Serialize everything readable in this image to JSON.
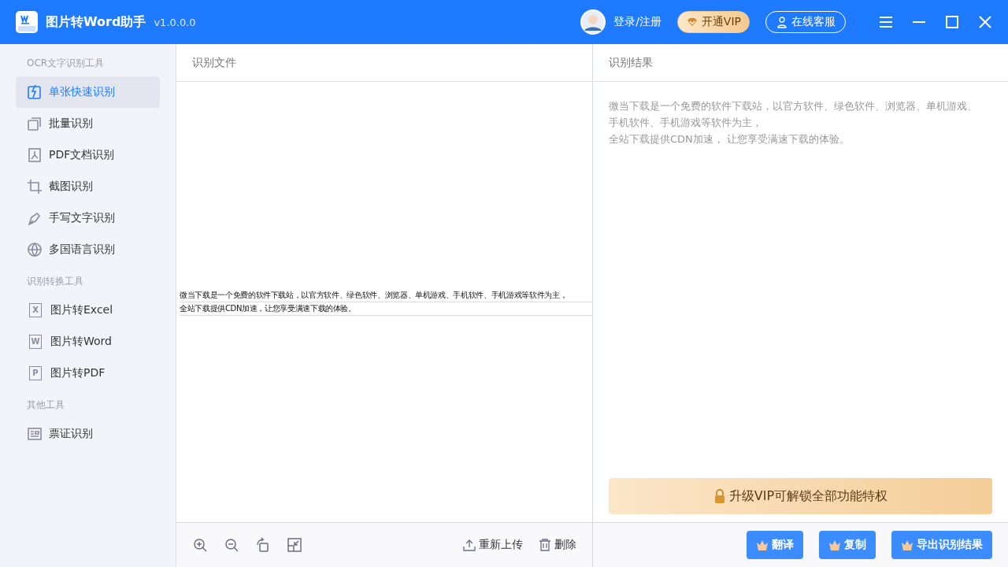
{
  "app": {
    "title": "图片转Word助手",
    "version": "v1.0.0.0"
  },
  "header": {
    "login": "登录/注册",
    "vip": "开通VIP",
    "service": "在线客服"
  },
  "sidebar": [
    {
      "heading": "OCR文字识别工具",
      "items": [
        {
          "label": "单张快速识别",
          "kind": "flash",
          "selected": true
        },
        {
          "label": "批量识别",
          "kind": "stack",
          "selected": false
        },
        {
          "label": "PDF文档识别",
          "kind": "pdf",
          "selected": false
        },
        {
          "label": "截图识别",
          "kind": "crop",
          "selected": false
        },
        {
          "label": "手写文字识别",
          "kind": "pen",
          "selected": false
        },
        {
          "label": "多国语言识别",
          "kind": "globe",
          "selected": false
        }
      ]
    },
    {
      "heading": "识别转换工具",
      "items": [
        {
          "label": "图片转Excel",
          "kind": "letter",
          "letter": "X",
          "selected": false
        },
        {
          "label": "图片转Word",
          "kind": "letter",
          "letter": "W",
          "selected": false
        },
        {
          "label": "图片转PDF",
          "kind": "letter",
          "letter": "P",
          "selected": false
        }
      ]
    },
    {
      "heading": "其他工具",
      "items": [
        {
          "label": "票证识别",
          "kind": "card",
          "selected": false
        }
      ]
    }
  ],
  "source": {
    "title": "识别文件",
    "lines": [
      "微当下载是一个免费的软件下载站，以官方软件、绿色软件、浏览器、单机游戏、手机软件、手机游戏等软件为主，",
      "全站下载提供CDN加速，让您享受满速下载的体验。"
    ],
    "tools": [
      {
        "kind": "zoom-in"
      },
      {
        "kind": "zoom-out"
      },
      {
        "kind": "rotate"
      },
      {
        "kind": "shrink"
      }
    ],
    "actions": [
      {
        "label": "重新上传",
        "kind": "upload"
      },
      {
        "label": "删除",
        "kind": "delete"
      }
    ]
  },
  "result": {
    "title": "识别结果",
    "lines": [
      "微当下载是一个免费的软件下载站，以官方软件、绿色软件、浏览器、单机游戏、手机软件、手机游戏等软件为主，",
      "全站下载提供CDN加速， 让您享受满速下载的体验。"
    ],
    "banner": "升级VIP可解锁全部功能特权",
    "buttons": [
      "翻译",
      "复制",
      "导出识别结果"
    ]
  }
}
